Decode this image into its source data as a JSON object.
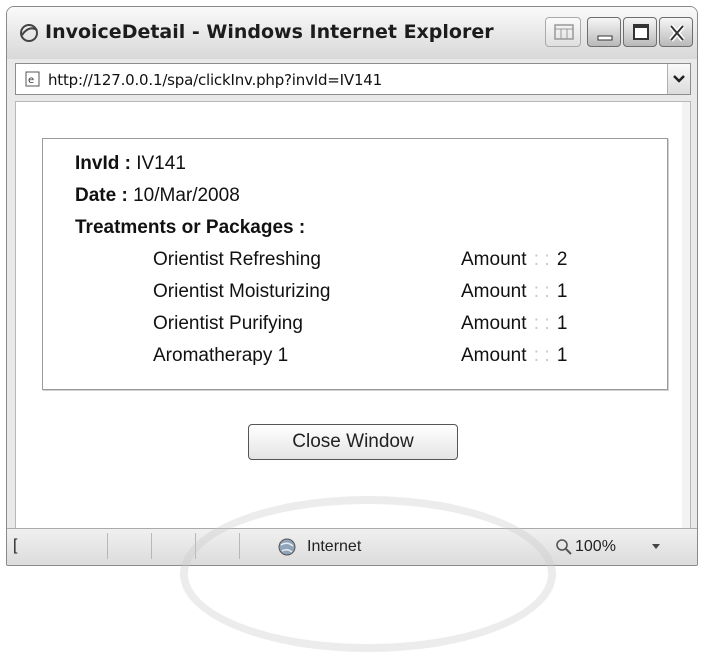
{
  "window": {
    "title": "InvoiceDetail - Windows Internet Explorer",
    "url": "http://127.0.0.1/spa/clickInv.php?invId=IV141"
  },
  "invoice": {
    "invid_label": "InvId :",
    "invid_value": "IV141",
    "date_label": "Date :",
    "date_value": "10/Mar/2008",
    "treatments_label": "Treatments or Packages :",
    "amount_label": "Amount",
    "amount_sep": ": :",
    "items": [
      {
        "name": "Orientist Refreshing",
        "amount": "2"
      },
      {
        "name": "Orientist Moisturizing",
        "amount": "1"
      },
      {
        "name": "Orientist Purifying",
        "amount": "1"
      },
      {
        "name": "Aromatherapy 1",
        "amount": "1"
      }
    ]
  },
  "close_button_label": "Close Window",
  "statusbar": {
    "left_char": "[",
    "zone": "Internet",
    "zoom": "100%"
  },
  "icons": {
    "title": "ie-logo-icon",
    "page": "ie-page-icon",
    "address_dropdown": "chevron-down-icon",
    "zone": "globe-icon",
    "zoom": "magnifier-icon",
    "zoom_dropdown": "chevron-down-icon"
  }
}
